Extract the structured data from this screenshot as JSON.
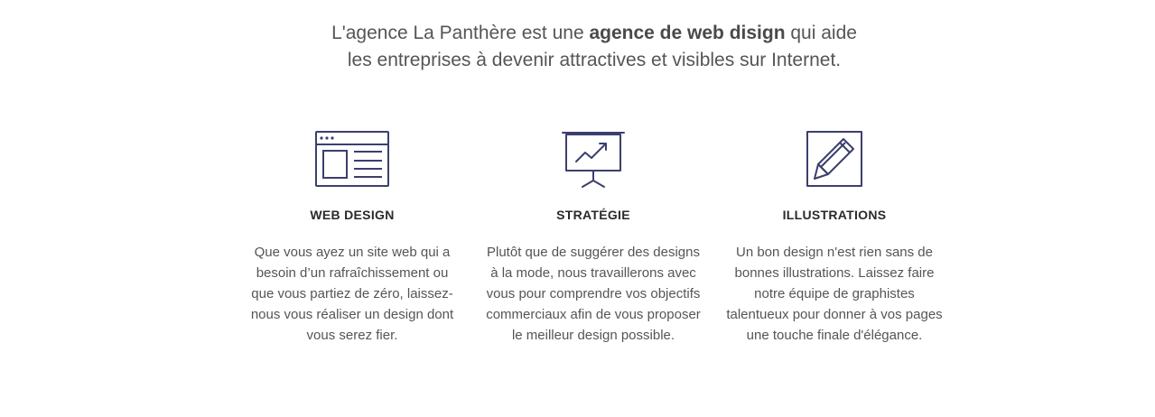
{
  "intro": {
    "line1_before": "L'agence La Panthère est une ",
    "line1_bold": "agence de web disign",
    "line1_after": " qui aide",
    "line2": "les entreprises à devenir attractives et visibles sur Internet."
  },
  "colors": {
    "icon_stroke": "#3b3f6e",
    "heading": "#2a2a2a",
    "text": "#555555"
  },
  "features": [
    {
      "icon": "browser-window-icon",
      "title": "WEB DESIGN",
      "description": "Que vous ayez un site web qui a besoin d’un rafraîchissement ou que vous partiez de zéro, laissez-nous vous réaliser un design dont vous serez fier."
    },
    {
      "icon": "presentation-chart-icon",
      "title": "STRATÉGIE",
      "description": "Plutôt que de suggérer des designs à la mode, nous travaillerons avec vous pour comprendre vos objectifs commerciaux afin de vous proposer le meilleur design possible."
    },
    {
      "icon": "pencil-square-icon",
      "title": "ILLUSTRATIONS",
      "description": "Un bon design n'est rien sans de bonnes illustrations. Laissez faire notre équipe de graphistes talentueux pour donner à vos pages une touche finale d'élégance."
    }
  ]
}
